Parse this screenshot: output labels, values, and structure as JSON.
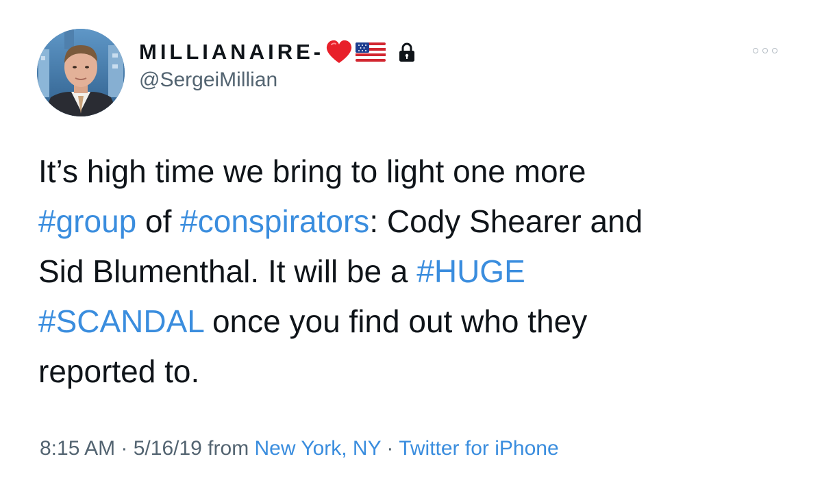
{
  "author": {
    "display_name": "MILLIANAIRE-",
    "badges": [
      "heart-emoji",
      "us-flag-emoji",
      "lock-icon"
    ],
    "handle": "@SergeiMillian",
    "avatar": "profile-photo"
  },
  "more_icon": "ellipsis-icon",
  "tweet": {
    "lines": [
      [
        {
          "t": "It’s high time we bring to light one more"
        }
      ],
      [
        {
          "t": "#group",
          "tag": true
        },
        {
          "t": " of "
        },
        {
          "t": "#conspirators",
          "tag": true
        },
        {
          "t": ": Cody Shearer and"
        }
      ],
      [
        {
          "t": "Sid Blumenthal. It will be a "
        },
        {
          "t": "#HUGE",
          "tag": true
        }
      ],
      [
        {
          "t": "#SCANDAL",
          "tag": true
        },
        {
          "t": " once you find out who they"
        }
      ],
      [
        {
          "t": "reported to."
        }
      ]
    ]
  },
  "meta": {
    "time": "8:15 AM",
    "sep1": " · ",
    "date": "5/16/19",
    "from": " from ",
    "location": "New York, NY",
    "sep2": " · ",
    "source": "Twitter for iPhone"
  },
  "colors": {
    "link": "#3a8dde",
    "secondary_text": "#536471",
    "primary_text": "#0f1419"
  }
}
